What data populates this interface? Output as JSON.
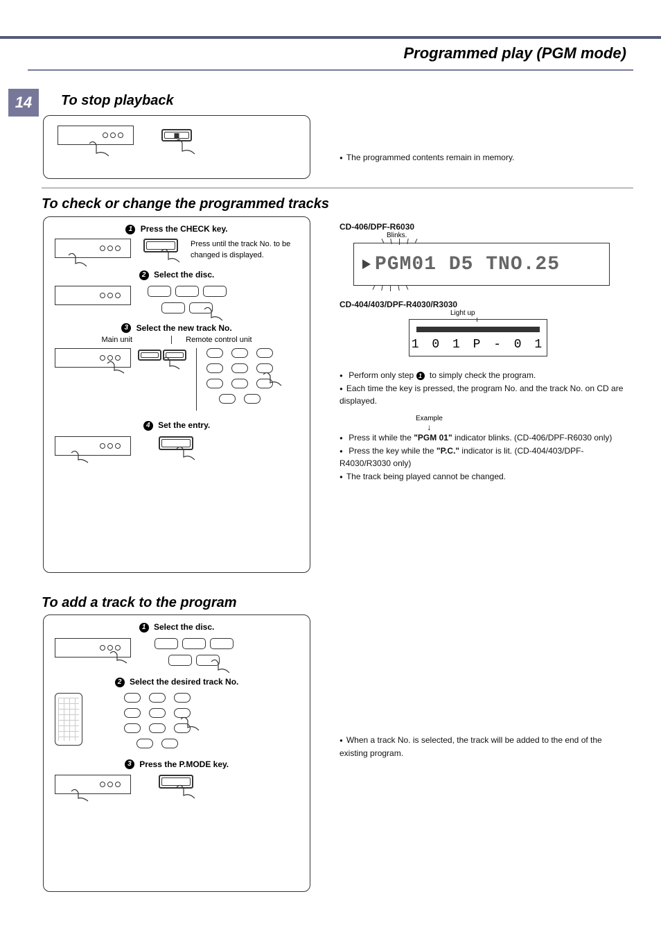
{
  "header": {
    "title": "Programmed play (PGM mode)",
    "page_number": "14"
  },
  "sections": {
    "stop": {
      "title": "To stop playback",
      "right_note": "The programmed contents remain in memory."
    },
    "check": {
      "title": "To check or change the programmed tracks",
      "steps": {
        "s1": "Press the CHECK key.",
        "s1_sub": "Press until the track No. to be changed is displayed.",
        "s2": "Select the disc.",
        "s3": "Select the new track No.",
        "s3_left": "Main unit",
        "s3_right": "Remote control unit",
        "s4": "Set the entry."
      },
      "right": {
        "model_a": "CD-406/DPF-R6030",
        "blinks": "Blinks.",
        "disp_a": "PGM01 D5  TNO.25",
        "model_b": "CD-404/403/DPF-R4030/R3030",
        "lightup": "Light up",
        "disp_b": "1 0 1   P - 0 1",
        "bul1a": "Perform only step ",
        "bul1b": " to simply check the program.",
        "bul2": "Each time the key is pressed, the program No.  and the track No. on CD are displayed.",
        "example": "Example",
        "bul3a": "Press it while the ",
        "bul3b": "\"PGM 01\"",
        "bul3c": " indicator blinks. (CD-406/DPF-R6030 only)",
        "bul4a": "Press the key while the  ",
        "bul4b": "\"P.C.\"",
        "bul4c": "  indicator is lit. (CD-404/403/DPF-R4030/R3030 only)",
        "bul5": "The track being played cannot be changed."
      }
    },
    "add": {
      "title": "To add a track to the program",
      "steps": {
        "s1": "Select the disc.",
        "s2": "Select the desired track No.",
        "s3": "Press the P.MODE key."
      },
      "right_note": "When a track No. is selected, the track will be added  to the end of the existing program."
    }
  }
}
